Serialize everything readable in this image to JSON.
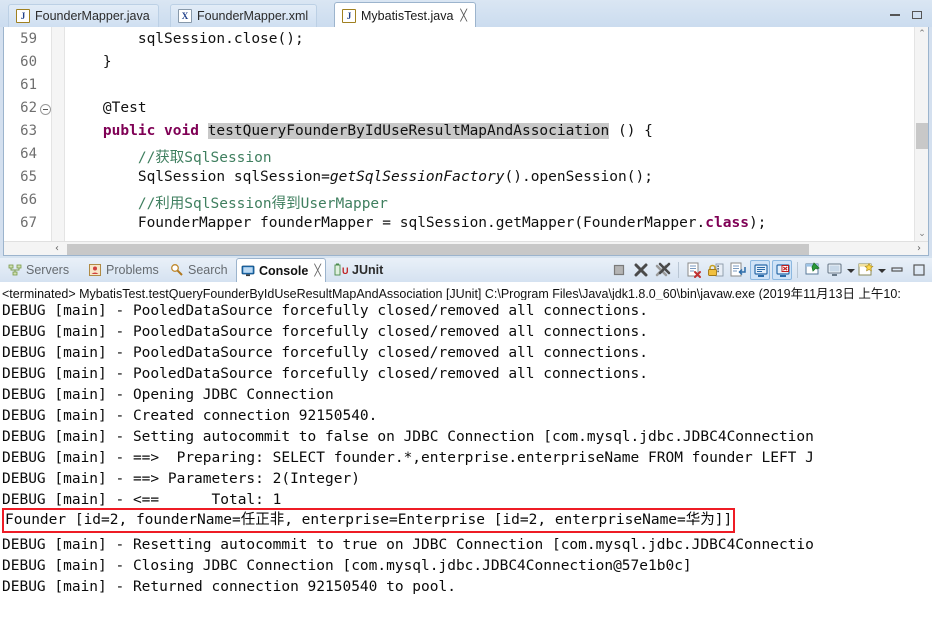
{
  "editor": {
    "tabs": [
      {
        "label": "FounderMapper.java",
        "icon": "java-file-icon",
        "icon_glyph": "J",
        "active": false,
        "closable": false
      },
      {
        "label": "FounderMapper.xml",
        "icon": "xml-file-icon",
        "icon_glyph": "X",
        "active": false,
        "closable": false
      },
      {
        "label": "MybatisTest.java",
        "icon": "java-file-icon",
        "icon_glyph": "J",
        "active": true,
        "closable": true
      }
    ],
    "close_glyph": "╳",
    "minimize_label": "Minimize",
    "maximize_label": "Maximize",
    "lines": [
      {
        "number": "59",
        "fold": false
      },
      {
        "number": "60",
        "fold": false
      },
      {
        "number": "61",
        "fold": false
      },
      {
        "number": "62",
        "fold": true
      },
      {
        "number": "63",
        "fold": false
      },
      {
        "number": "64",
        "fold": false
      },
      {
        "number": "65",
        "fold": false
      },
      {
        "number": "66",
        "fold": false
      },
      {
        "number": "67",
        "fold": false
      }
    ],
    "code": {
      "l59": "        sqlSession.close();",
      "l60": "    }",
      "l61": "",
      "l62": "    @Test",
      "l63_kw": "    public void ",
      "l63_sel": "testQueryFounderByIdUseResultMapAndAssociation",
      "l63_tail": " () {",
      "l64": "        //获取SqlSession",
      "l65_a": "        SqlSession sqlSession=",
      "l65_it": "getSqlSessionFactory",
      "l65_b": "().openSession();",
      "l66": "        //利用SqlSession得到UserMapper",
      "l67_a": "        FounderMapper founderMapper = sqlSession.getMapper(FounderMapper.",
      "l67_kw": "class",
      "l67_b": ");"
    },
    "scroll": {
      "left_arrow": "‹",
      "right_arrow": "›",
      "up_arrow": "⌃",
      "down_arrow": "⌄"
    }
  },
  "console": {
    "tabs": [
      {
        "label": "Servers",
        "icon": "servers-icon",
        "active": false,
        "closable": false
      },
      {
        "label": "Problems",
        "icon": "problems-icon",
        "active": false,
        "closable": false
      },
      {
        "label": "Search",
        "icon": "search-icon",
        "active": false,
        "closable": false
      },
      {
        "label": "Console",
        "icon": "console-icon",
        "active": true,
        "closable": true
      },
      {
        "label": "JUnit",
        "icon": "junit-icon",
        "active": false,
        "closable": false
      }
    ],
    "close_glyph": "╳",
    "toolbar": [
      {
        "name": "terminate-button",
        "tooltip": "Terminate",
        "boxed": false
      },
      {
        "name": "remove-launch-button",
        "tooltip": "Remove Launch",
        "boxed": false
      },
      {
        "name": "remove-all-terminated-button",
        "tooltip": "Remove All Terminated Launches",
        "boxed": false
      },
      {
        "name": "clear-console-button",
        "tooltip": "Clear Console",
        "boxed": false
      },
      {
        "name": "scroll-lock-button",
        "tooltip": "Scroll Lock",
        "boxed": false
      },
      {
        "name": "word-wrap-button",
        "tooltip": "Word Wrap",
        "boxed": false
      },
      {
        "name": "show-console-on-output-button",
        "tooltip": "Show Console When Standard Out Changes",
        "boxed": true
      },
      {
        "name": "show-console-on-error-button",
        "tooltip": "Show Console When Standard Error Changes",
        "boxed": true
      },
      {
        "name": "pin-console-button",
        "tooltip": "Pin Console",
        "boxed": false
      },
      {
        "name": "display-selected-console-button",
        "tooltip": "Display Selected Console",
        "boxed": false
      },
      {
        "name": "open-console-button",
        "tooltip": "Open Console",
        "boxed": false
      }
    ],
    "terminated_line": "<terminated> MybatisTest.testQueryFounderByIdUseResultMapAndAssociation [JUnit] C:\\Program Files\\Java\\jdk1.8.0_60\\bin\\javaw.exe (2019年11月13日 上午10:",
    "output": [
      {
        "text": "DEBUG [main] - PooledDataSource forcefully closed/removed all connections.",
        "highlight": false
      },
      {
        "text": "DEBUG [main] - PooledDataSource forcefully closed/removed all connections.",
        "highlight": false
      },
      {
        "text": "DEBUG [main] - PooledDataSource forcefully closed/removed all connections.",
        "highlight": false
      },
      {
        "text": "DEBUG [main] - PooledDataSource forcefully closed/removed all connections.",
        "highlight": false
      },
      {
        "text": "DEBUG [main] - Opening JDBC Connection",
        "highlight": false
      },
      {
        "text": "DEBUG [main] - Created connection 92150540.",
        "highlight": false
      },
      {
        "text": "DEBUG [main] - Setting autocommit to false on JDBC Connection [com.mysql.jdbc.JDBC4Connection",
        "highlight": false
      },
      {
        "text": "DEBUG [main] - ==>  Preparing: SELECT founder.*,enterprise.enterpriseName FROM founder LEFT J",
        "highlight": false
      },
      {
        "text": "DEBUG [main] - ==> Parameters: 2(Integer)",
        "highlight": false
      },
      {
        "text": "DEBUG [main] - <==      Total: 1",
        "highlight": false
      },
      {
        "text": "Founder [id=2, founderName=任正非, enterprise=Enterprise [id=2, enterpriseName=华为]]",
        "highlight": true
      },
      {
        "text": "DEBUG [main] - Resetting autocommit to true on JDBC Connection [com.mysql.jdbc.JDBC4Connectio",
        "highlight": false
      },
      {
        "text": "DEBUG [main] - Closing JDBC Connection [com.mysql.jdbc.JDBC4Connection@57e1b0c]",
        "highlight": false
      },
      {
        "text": "DEBUG [main] - Returned connection 92150540 to pool.",
        "highlight": false
      }
    ]
  },
  "colors": {
    "highlight_border": "#ee1c25",
    "keyword": "#7f0055",
    "comment": "#3f7f5f",
    "selection": "#c8c8c8",
    "tab_active_bg": "#ffffff",
    "panel_bg": "#d4e0ef",
    "toolbar_active": "#cfe3f7"
  }
}
